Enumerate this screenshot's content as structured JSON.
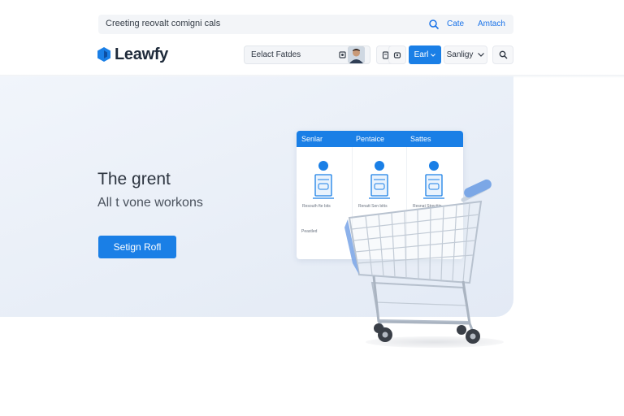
{
  "topbar": {
    "query": "Creeting reovalt comigni cals",
    "links": [
      "Cate",
      "Amtach"
    ],
    "icon": "search-icon"
  },
  "brand": {
    "name": "Leawfy",
    "color": "#1a7fe6"
  },
  "header": {
    "select_label": "Eelact Fatdes",
    "primary_button": "Earl",
    "dropdown_label": "Sanligy",
    "icons": [
      "camera-icon",
      "avatar",
      "bookmark-icon",
      "settings-icon",
      "chevron-down-icon",
      "search-icon"
    ]
  },
  "hero": {
    "title": "The grent",
    "subtitle": "All t vone workons",
    "cta": "Setign Rofl"
  },
  "card": {
    "headers": [
      "Senlar",
      "Pentaice",
      "Sattes"
    ],
    "captions": [
      "Resouth fte bits",
      "Renatt Sen bitts",
      "Resnat Strecttin"
    ],
    "footnote": "Peastled"
  },
  "colors": {
    "accent": "#1a7fe6",
    "hero_bg": "#e8eef7",
    "text_dark": "#1e2a3a"
  }
}
